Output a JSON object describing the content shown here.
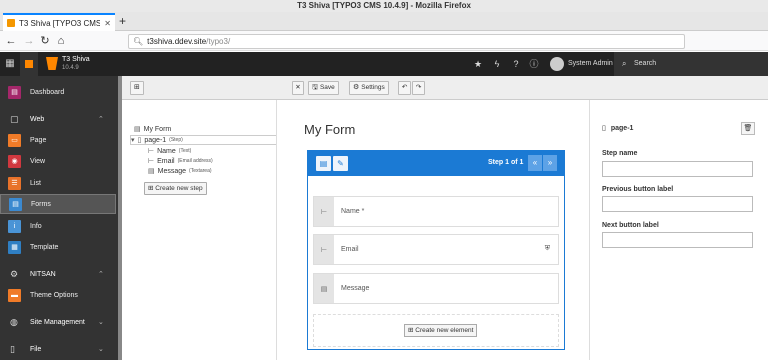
{
  "browser": {
    "window_title": "T3 Shiva [TYPO3 CMS 10.4.9] - Mozilla Firefox",
    "tab_title": "T3 Shiva [TYPO3 CMS 10",
    "tab_close": "✕",
    "new_tab": "+",
    "url_host": "t3shiva.ddev.site",
    "url_path": "/typo3/"
  },
  "topbar": {
    "site_name": "T3 Shiva",
    "version": "10.4.9",
    "user_name": "System Admin",
    "search_label": "Search"
  },
  "module_menu": {
    "dashboard": "Dashboard",
    "web": "Web",
    "page": "Page",
    "view": "View",
    "list": "List",
    "forms": "Forms",
    "info": "Info",
    "template": "Template",
    "nitsan": "NITSAN",
    "theme_options": "Theme Options",
    "site_management": "Site Management",
    "file": "File"
  },
  "toolbar": {
    "save": "Save",
    "settings": "Settings"
  },
  "tree": {
    "form": "My Form",
    "page_name": "page-1",
    "page_type": "(Step)",
    "items": [
      {
        "name": "Name",
        "type": "(Text)"
      },
      {
        "name": "Email",
        "type": "(Email address)"
      },
      {
        "name": "Message",
        "type": "(Textarea)"
      }
    ],
    "create_step": "Create new step"
  },
  "stage": {
    "title": "My Form",
    "step_label": "Step 1 of 1",
    "prev": "«",
    "next": "»",
    "fields": [
      {
        "label": "Name *"
      },
      {
        "label": "Email"
      },
      {
        "label": "Message"
      }
    ],
    "create_element": "Create new element"
  },
  "inspector": {
    "title": "page-1",
    "step_name_label": "Step name",
    "prev_button_label": "Previous button label",
    "next_button_label": "Next button label"
  },
  "colors": {
    "accent": "#1b7ad4",
    "typo3_orange": "#ff8700"
  }
}
